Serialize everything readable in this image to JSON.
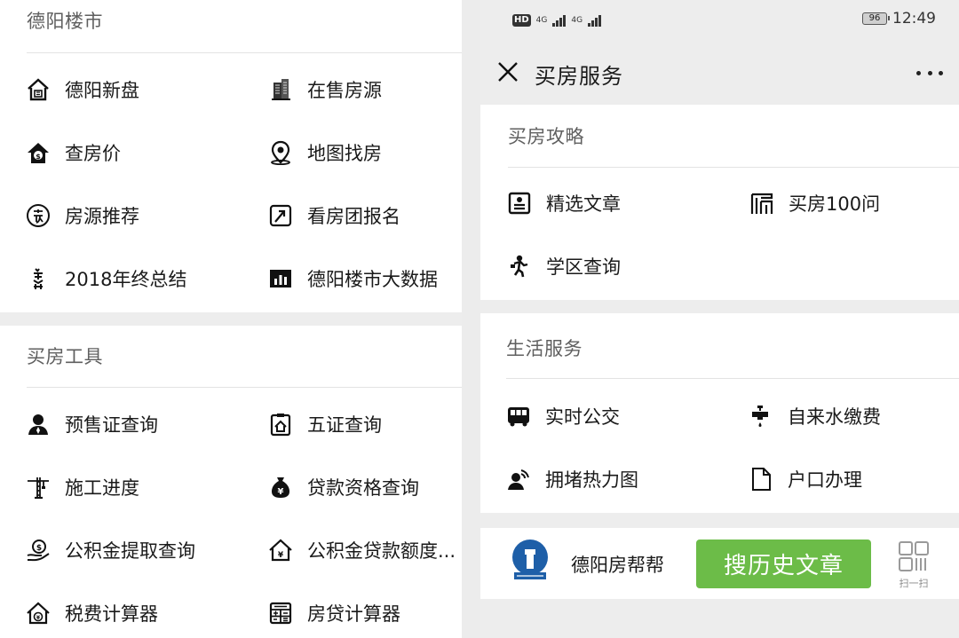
{
  "left": {
    "sections": [
      {
        "title": "德阳楼市",
        "items": [
          {
            "label": "德阳新盘",
            "icon": "new-house-icon"
          },
          {
            "label": "在售房源",
            "icon": "building-icon"
          },
          {
            "label": "查房价",
            "icon": "house-price-icon"
          },
          {
            "label": "地图找房",
            "icon": "map-pin-icon"
          },
          {
            "label": "房源推荐",
            "icon": "recommend-icon"
          },
          {
            "label": "看房团报名",
            "icon": "signup-icon"
          },
          {
            "label": "2018年终总结",
            "icon": "summary-icon"
          },
          {
            "label": "德阳楼市大数据",
            "icon": "bar-chart-icon"
          }
        ]
      },
      {
        "title": "买房工具",
        "items": [
          {
            "label": "预售证查询",
            "icon": "person-icon"
          },
          {
            "label": "五证查询",
            "icon": "certificate-icon"
          },
          {
            "label": "施工进度",
            "icon": "crane-icon"
          },
          {
            "label": "贷款资格查询",
            "icon": "money-bag-icon"
          },
          {
            "label": "公积金提取查询",
            "icon": "fund-withdraw-icon"
          },
          {
            "label": "公积金贷款额度...",
            "icon": "fund-loan-icon"
          },
          {
            "label": "税费计算器",
            "icon": "tax-house-icon"
          },
          {
            "label": "房贷计算器",
            "icon": "calculator-icon"
          }
        ]
      }
    ]
  },
  "right": {
    "status_bar": {
      "hd": "HD",
      "network_1": "4G",
      "network_2": "4G",
      "battery": "96",
      "time": "12:49"
    },
    "nav": {
      "title": "买房服务"
    },
    "sections": [
      {
        "title": "买房攻略",
        "items": [
          {
            "label": "精选文章",
            "icon": "article-icon"
          },
          {
            "label": "买房100问",
            "icon": "faq-icon"
          },
          {
            "label": "学区查询",
            "icon": "student-icon"
          }
        ]
      },
      {
        "title": "生活服务",
        "items": [
          {
            "label": "实时公交",
            "icon": "bus-icon"
          },
          {
            "label": "自来水缴费",
            "icon": "water-tap-icon"
          },
          {
            "label": "拥堵热力图",
            "icon": "traffic-heat-icon"
          },
          {
            "label": "户口办理",
            "icon": "document-icon"
          }
        ]
      }
    ],
    "footer": {
      "account_name": "德阳房帮帮",
      "search_button": "搜历史文章",
      "scan_label": "扫一扫"
    }
  },
  "colors": {
    "accent_green": "#6cbc48",
    "section_gap": "#ededed",
    "divider": "#e3e3e3",
    "text": "#1a1a1a",
    "section_title": "#5f5f5f"
  }
}
